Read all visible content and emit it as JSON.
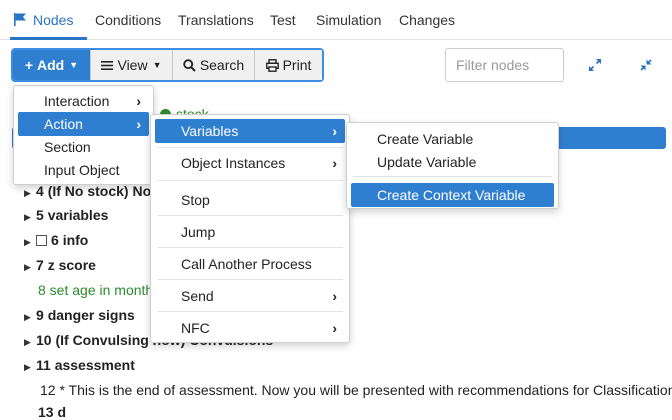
{
  "tabs": [
    {
      "label": "Nodes"
    },
    {
      "label": "Conditions"
    },
    {
      "label": "Translations"
    },
    {
      "label": "Test"
    },
    {
      "label": "Simulation"
    },
    {
      "label": "Changes"
    }
  ],
  "toolbar": {
    "add_label": "Add",
    "view_label": "View",
    "search_label": "Search",
    "print_label": "Print"
  },
  "filter": {
    "placeholder": "Filter nodes"
  },
  "tree": {
    "stock_label": "stock",
    "rows": [
      {
        "number": "4",
        "text": "(If No stock) No"
      },
      {
        "number": "5",
        "text": "variables"
      },
      {
        "number": "6",
        "text": "info"
      },
      {
        "number": "7",
        "text": "z score"
      },
      {
        "text": "8 set age in month"
      },
      {
        "number": "9",
        "text": "danger signs"
      },
      {
        "number": "10",
        "text": "(If Convulsing now) Convulsions"
      },
      {
        "number": "11",
        "text": "assessment"
      },
      {
        "text": "12 * This is the end of assessment. Now you will be presented with recommendations for Classification"
      },
      {
        "text": "13 d"
      }
    ]
  },
  "menu_add": {
    "items": [
      {
        "label": "Interaction"
      },
      {
        "label": "Action"
      },
      {
        "label": "Section"
      },
      {
        "label": "Input Object"
      }
    ]
  },
  "menu_action": {
    "items": [
      {
        "label": "Variables"
      },
      {
        "label": "Object Instances"
      },
      {
        "label": "Stop"
      },
      {
        "label": "Jump"
      },
      {
        "label": "Call Another Process"
      },
      {
        "label": "Send"
      },
      {
        "label": "NFC"
      }
    ]
  },
  "menu_variables": {
    "items": [
      {
        "label": "Create Variable"
      },
      {
        "label": "Update Variable"
      },
      {
        "label": "Create Context Variable"
      }
    ]
  },
  "colors": {
    "accent": "#2f7fd1",
    "green": "#2e8b2e"
  }
}
